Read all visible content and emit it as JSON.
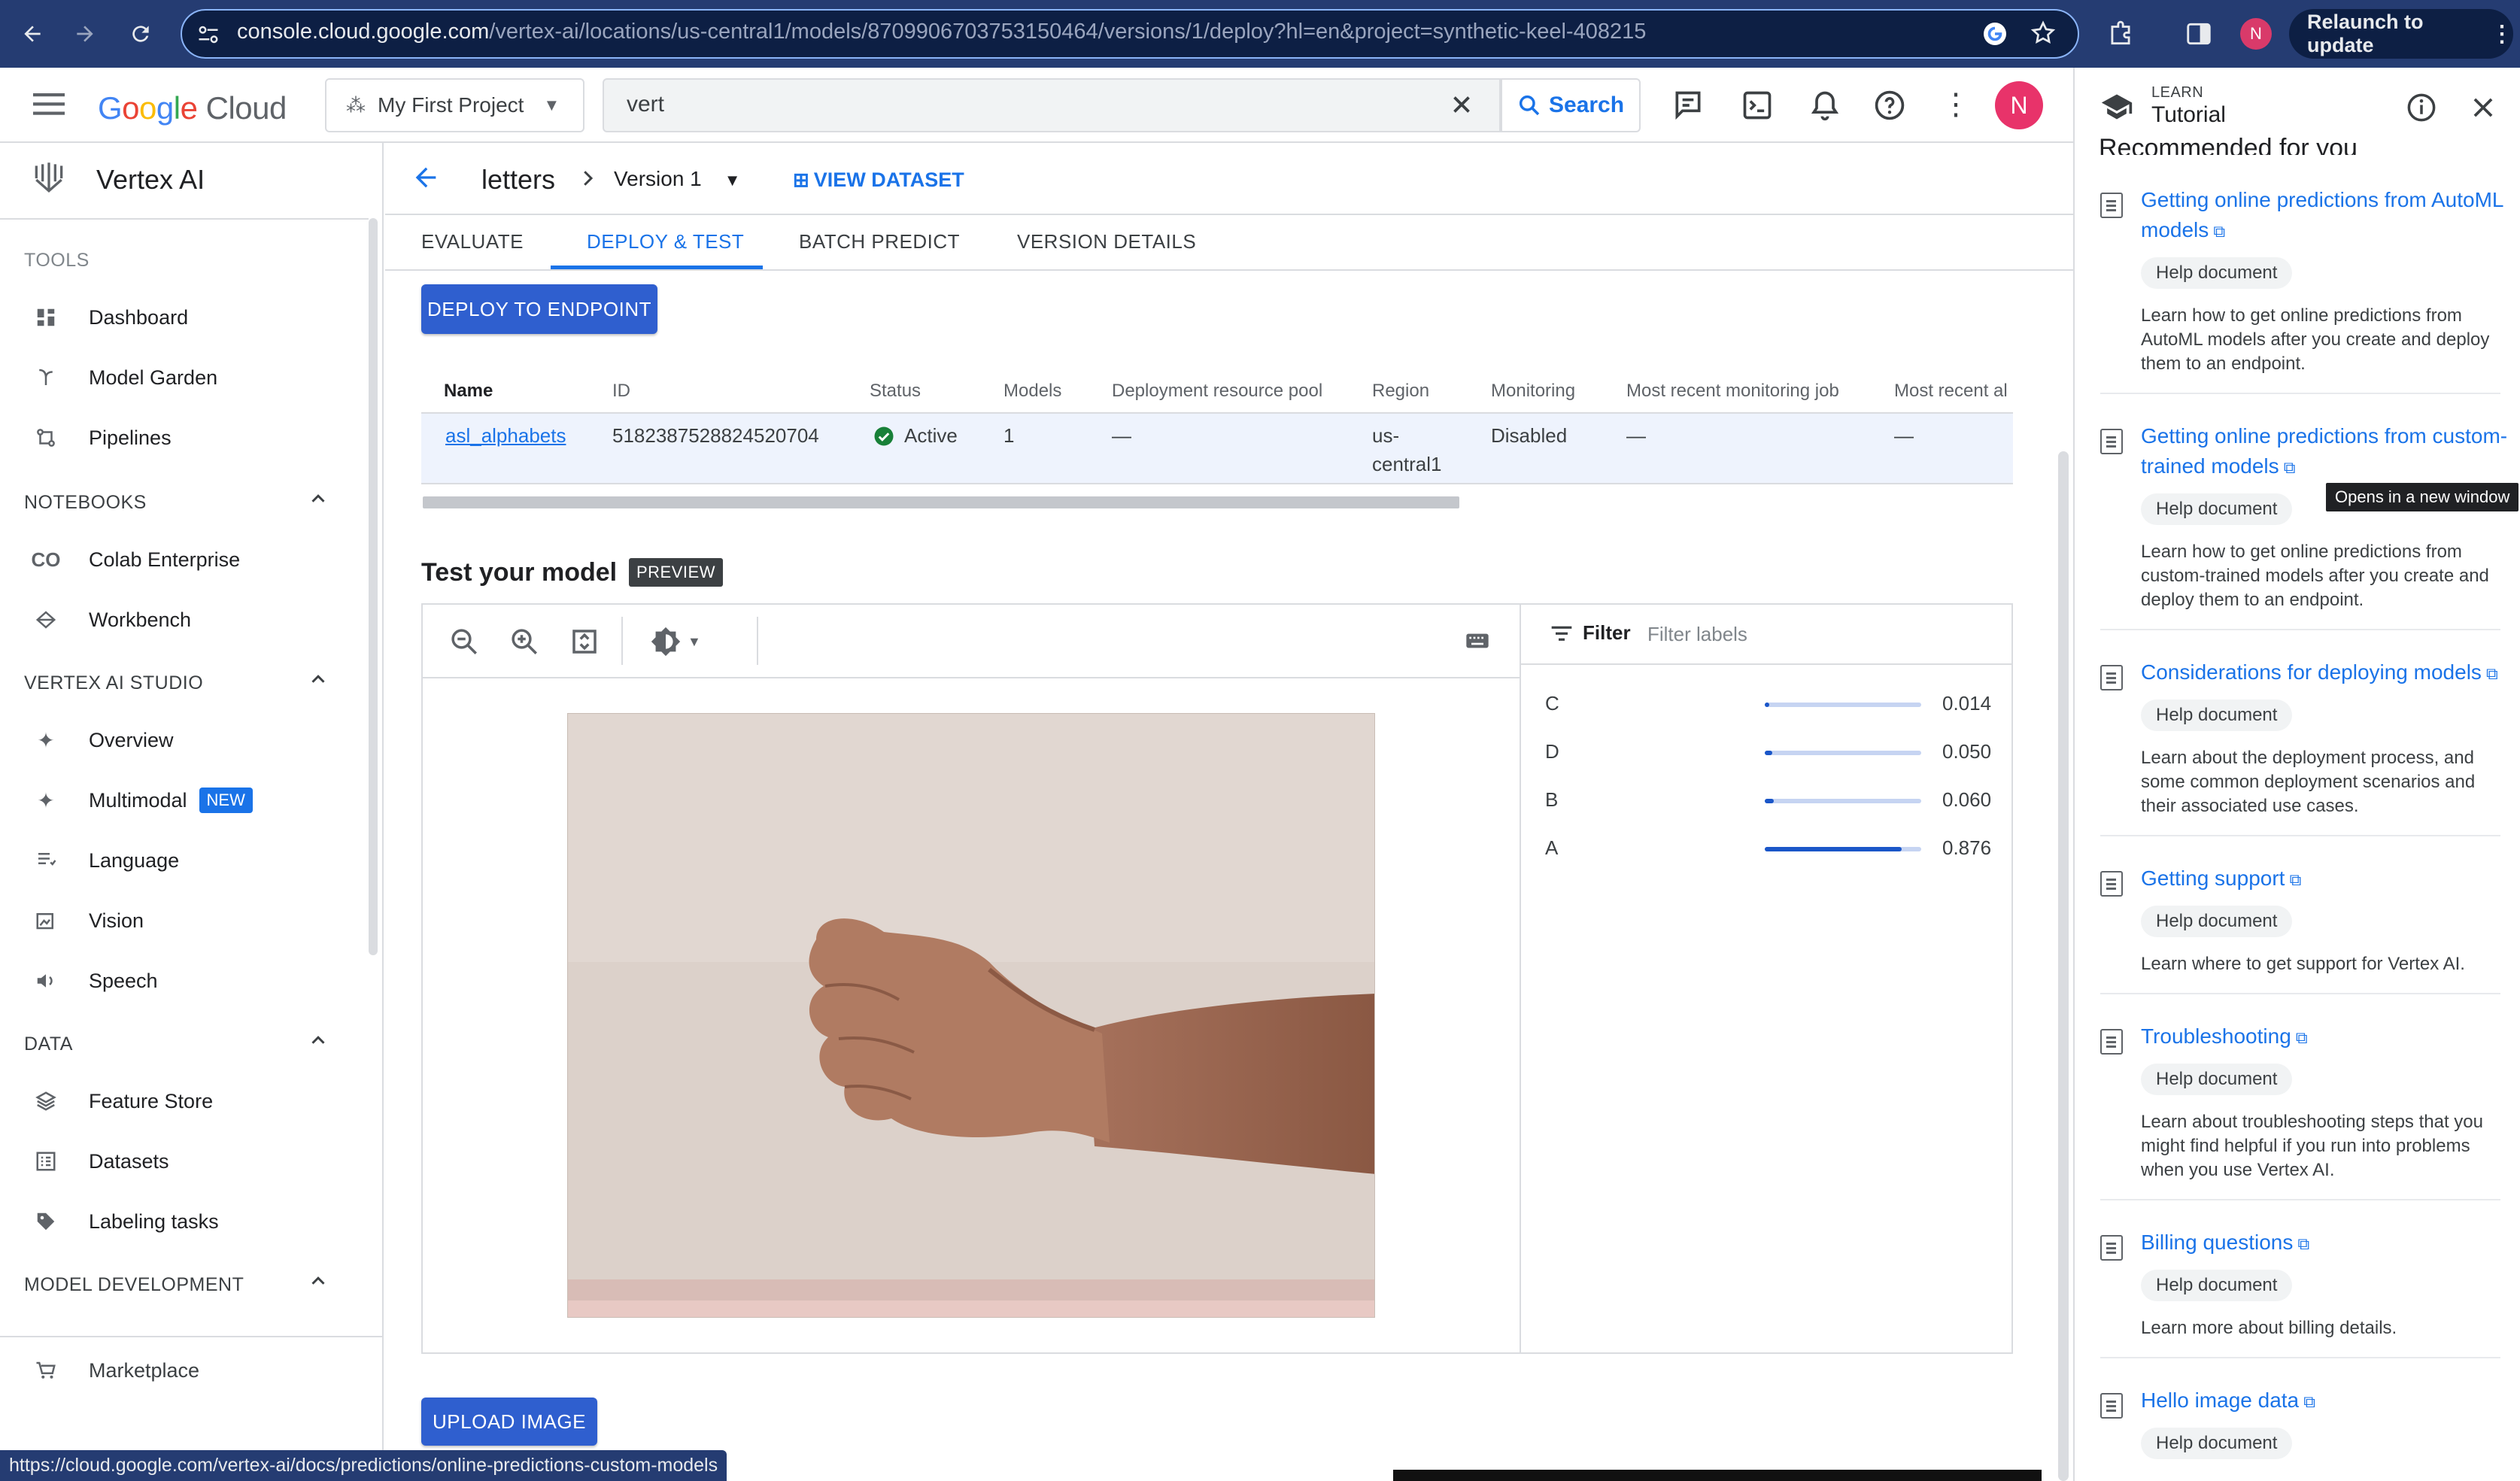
{
  "browser": {
    "url_host": "console.cloud.google.com",
    "url_path": "/vertex-ai/locations/us-central1/models/8709906703753150464/versions/1/deploy?hl=en&project=synthetic-keel-408215",
    "profile_initial": "N",
    "relaunch_label": "Relaunch to update",
    "status_url": "https://cloud.google.com/vertex-ai/docs/predictions/online-predictions-custom-models"
  },
  "header": {
    "logo": "Google Cloud",
    "project": "My First Project",
    "search_value": "vert",
    "search_label": "Search",
    "avatar_initial": "N"
  },
  "nav": {
    "product": "Vertex AI",
    "tools_heading": "TOOLS",
    "tools": [
      "Dashboard",
      "Model Garden",
      "Pipelines"
    ],
    "notebooks_heading": "NOTEBOOKS",
    "notebooks": [
      "Colab Enterprise",
      "Workbench"
    ],
    "studio_heading": "VERTEX AI STUDIO",
    "studio": [
      "Overview",
      "Multimodal",
      "Language",
      "Vision",
      "Speech"
    ],
    "new_badge": "NEW",
    "data_heading": "DATA",
    "data": [
      "Feature Store",
      "Datasets",
      "Labeling tasks"
    ],
    "modeldev_heading": "MODEL DEVELOPMENT",
    "marketplace": "Marketplace"
  },
  "breadcrumb": {
    "model": "letters",
    "version": "Version 1",
    "view_dataset": "VIEW DATASET"
  },
  "tabs": [
    "EVALUATE",
    "DEPLOY & TEST",
    "BATCH PREDICT",
    "VERSION DETAILS"
  ],
  "deploy_button": "DEPLOY TO ENDPOINT",
  "endpoint_table": {
    "headers": [
      "Name",
      "ID",
      "Status",
      "Models",
      "Deployment resource pool",
      "Region",
      "Monitoring",
      "Most recent monitoring job",
      "Most recent al"
    ],
    "row": {
      "name": "asl_alphabets",
      "id": "5182387528824520704",
      "status": "Active",
      "models": "1",
      "pool": "—",
      "region_line1": "us-",
      "region_line2": "central1",
      "monitoring": "Disabled",
      "recent_job": "—",
      "recent_al": "—"
    }
  },
  "test": {
    "title": "Test your model",
    "badge": "PREVIEW",
    "filter_label": "Filter",
    "filter_placeholder": "Filter labels",
    "predictions": [
      {
        "label": "C",
        "score": 0.014,
        "display": "0.014"
      },
      {
        "label": "D",
        "score": 0.05,
        "display": "0.050"
      },
      {
        "label": "B",
        "score": 0.06,
        "display": "0.060"
      },
      {
        "label": "A",
        "score": 0.876,
        "display": "0.876"
      }
    ],
    "upload_button": "UPLOAD IMAGE"
  },
  "learn": {
    "kicker": "LEARN",
    "title": "Tutorial",
    "recommended": "Recommended for you",
    "tooltip": "Opens in a new window",
    "chip": "Help document",
    "cards": [
      {
        "title": "Getting online predictions from AutoML models",
        "desc": "Learn how to get online predictions from AutoML models after you create and deploy them to an endpoint."
      },
      {
        "title": "Getting online predictions from custom-trained models",
        "desc": "Learn how to get online predictions from custom-trained models after you create and deploy them to an endpoint."
      },
      {
        "title": "Considerations for deploying models",
        "desc": "Learn about the deployment process, and some common deployment scenarios and their associated use cases."
      },
      {
        "title": "Getting support",
        "desc": "Learn where to get support for Vertex AI."
      },
      {
        "title": "Troubleshooting",
        "desc": "Learn about troubleshooting steps that you might find helpful if you run into problems when you use Vertex AI."
      },
      {
        "title": "Billing questions",
        "desc": "Learn more about billing details."
      },
      {
        "title": "Hello image data",
        "desc": ""
      }
    ]
  },
  "colors": {
    "accent": "#1a73e8",
    "chrome": "#253c72",
    "button": "#2f5fcf"
  }
}
